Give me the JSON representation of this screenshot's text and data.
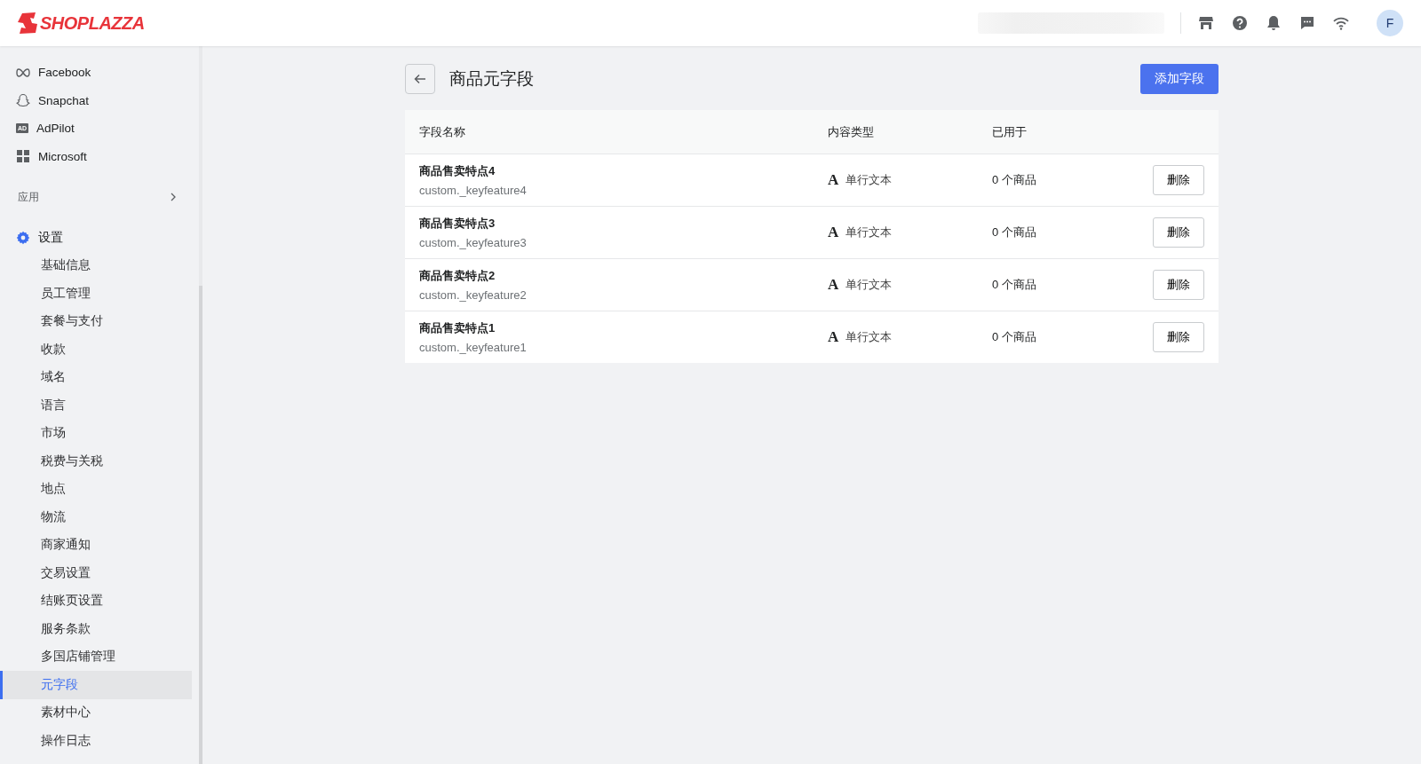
{
  "header": {
    "logo": "SHOPLAZZA",
    "avatar": "F"
  },
  "sidebar": {
    "channels": [
      {
        "label": "Facebook",
        "kind": "facebook"
      },
      {
        "label": "Snapchat",
        "kind": "snapchat"
      },
      {
        "label": "AdPilot",
        "kind": "adpilot",
        "icon_text": "AD"
      },
      {
        "label": "Microsoft",
        "kind": "microsoft"
      }
    ],
    "apps_section": {
      "label": "应用",
      "expanded": false
    },
    "settings": {
      "label": "设置",
      "items": [
        {
          "label": "基础信息",
          "selected": false
        },
        {
          "label": "员工管理",
          "selected": false
        },
        {
          "label": "套餐与支付",
          "selected": false
        },
        {
          "label": "收款",
          "selected": false
        },
        {
          "label": "域名",
          "selected": false
        },
        {
          "label": "语言",
          "selected": false
        },
        {
          "label": "市场",
          "selected": false
        },
        {
          "label": "税费与关税",
          "selected": false
        },
        {
          "label": "地点",
          "selected": false
        },
        {
          "label": "物流",
          "selected": false
        },
        {
          "label": "商家通知",
          "selected": false
        },
        {
          "label": "交易设置",
          "selected": false
        },
        {
          "label": "结账页设置",
          "selected": false
        },
        {
          "label": "服务条款",
          "selected": false
        },
        {
          "label": "多国店铺管理",
          "selected": false
        },
        {
          "label": "元字段",
          "selected": true
        },
        {
          "label": "素材中心",
          "selected": false
        },
        {
          "label": "操作日志",
          "selected": false
        }
      ]
    }
  },
  "page": {
    "title": "商品元字段",
    "add_button": "添加字段"
  },
  "table": {
    "columns": [
      "字段名称",
      "内容类型",
      "已用于"
    ],
    "rows": [
      {
        "name": "商品售卖特点4",
        "key": "custom._keyfeature4",
        "type_icon": "A",
        "type": "单行文本",
        "used": "0 个商品",
        "action": "删除"
      },
      {
        "name": "商品售卖特点3",
        "key": "custom._keyfeature3",
        "type_icon": "A",
        "type": "单行文本",
        "used": "0 个商品",
        "action": "删除"
      },
      {
        "name": "商品售卖特点2",
        "key": "custom._keyfeature2",
        "type_icon": "A",
        "type": "单行文本",
        "used": "0 个商品",
        "action": "删除"
      },
      {
        "name": "商品售卖特点1",
        "key": "custom._keyfeature1",
        "type_icon": "A",
        "type": "单行文本",
        "used": "0 个商品",
        "action": "删除"
      }
    ]
  }
}
